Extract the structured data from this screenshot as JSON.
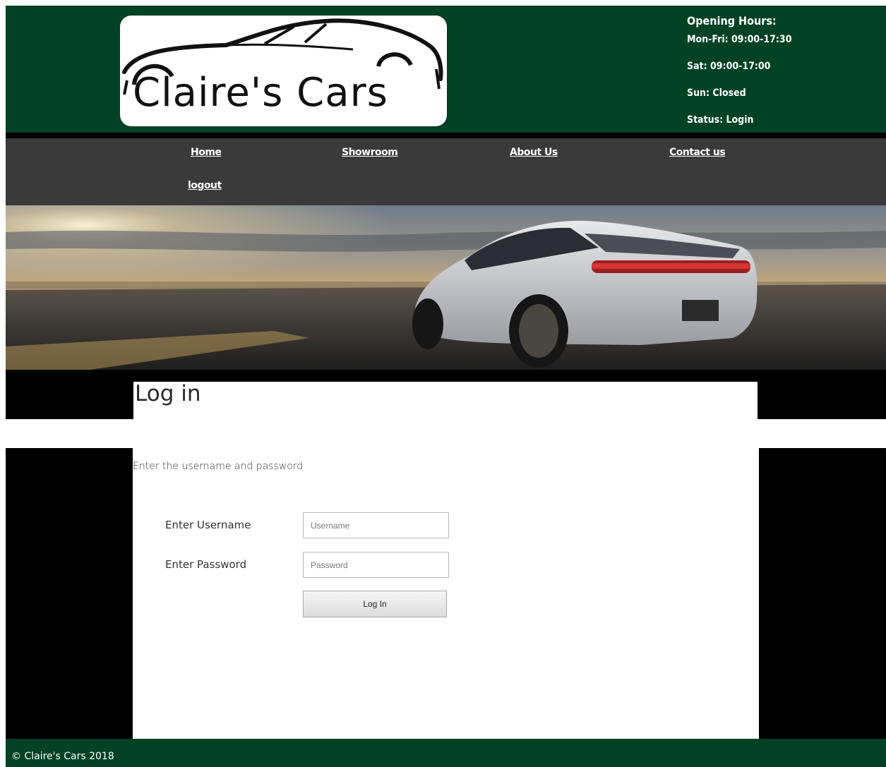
{
  "header": {
    "logo_text": "Claire's Cars",
    "hours": {
      "heading": "Opening Hours:",
      "mon_fri": "Mon-Fri: 09:00-17:30",
      "sat": "Sat: 09:00-17:00",
      "sun": "Sun: Closed",
      "status": "Status: Login"
    }
  },
  "nav": {
    "items": [
      "Home",
      "Showroom",
      "About Us",
      "Contact us",
      "logout"
    ]
  },
  "main": {
    "title": "Log in",
    "instruction": "Enter the username and password",
    "form": {
      "username_label": "Enter Username",
      "username_placeholder": "Username",
      "password_label": "Enter Password",
      "password_placeholder": "Password",
      "submit_label": "Log In"
    }
  },
  "footer": {
    "copyright": "© Claire's Cars 2018"
  },
  "colors": {
    "header_green": "#004225",
    "nav_gray": "#3a3a3a",
    "frame_black": "#000000"
  }
}
